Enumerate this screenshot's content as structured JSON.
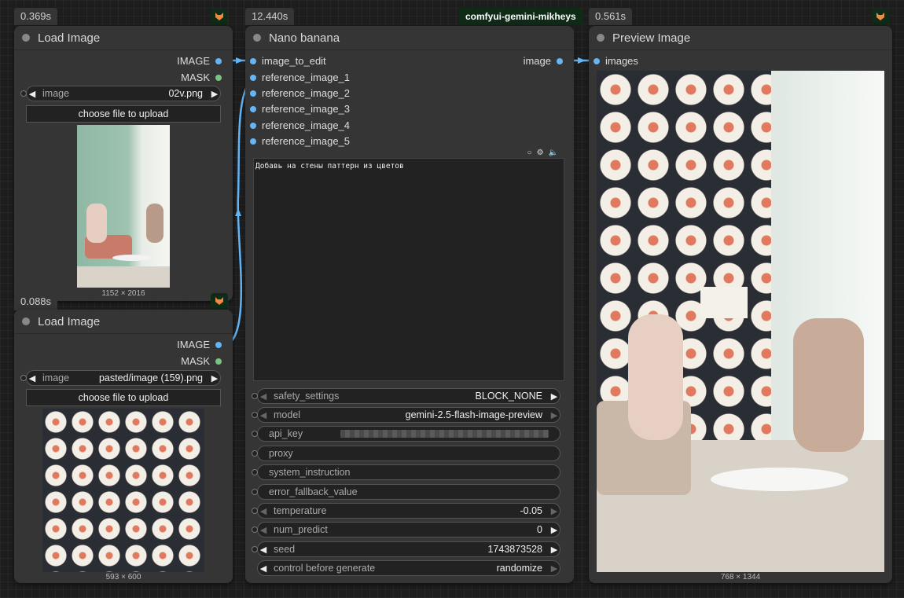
{
  "badges": {
    "load1_time": "0.369s",
    "nano_time": "12.440s",
    "nano_title": "comfyui-gemini-mikheys",
    "preview_time": "0.561s",
    "load2_time": "0.088s"
  },
  "load1": {
    "title": "Load Image",
    "out_image": "IMAGE",
    "out_mask": "MASK",
    "image_label": "image",
    "image_value": "02v.png",
    "upload": "choose file to upload",
    "dims": "1152 × 2016"
  },
  "load2": {
    "title": "Load Image",
    "out_image": "IMAGE",
    "out_mask": "MASK",
    "image_label": "image",
    "image_value": "pasted/image (159).png",
    "upload": "choose file to upload",
    "dims": "593 × 600"
  },
  "nano": {
    "title": "Nano banana",
    "inputs": [
      "image_to_edit",
      "reference_image_1",
      "reference_image_2",
      "reference_image_3",
      "reference_image_4",
      "reference_image_5"
    ],
    "output": "image",
    "prompt": "Добавь на стены паттерн из цветов",
    "widgets": {
      "safety_label": "safety_settings",
      "safety_value": "BLOCK_NONE",
      "model_label": "model",
      "model_value": "gemini-2.5-flash-image-preview",
      "api_label": "api_key",
      "proxy_label": "proxy",
      "system_label": "system_instruction",
      "error_label": "error_fallback_value",
      "temp_label": "temperature",
      "temp_value": "-0.05",
      "num_label": "num_predict",
      "num_value": "0",
      "seed_label": "seed",
      "seed_value": "1743873528",
      "control_label": "control before generate",
      "control_value": "randomize"
    }
  },
  "preview": {
    "title": "Preview Image",
    "input": "images",
    "dims": "768 × 1344"
  },
  "colors": {
    "slot_image": "#64b5f6",
    "slot_mask": "#7bc47f",
    "group_badge": "#0f2a17"
  }
}
